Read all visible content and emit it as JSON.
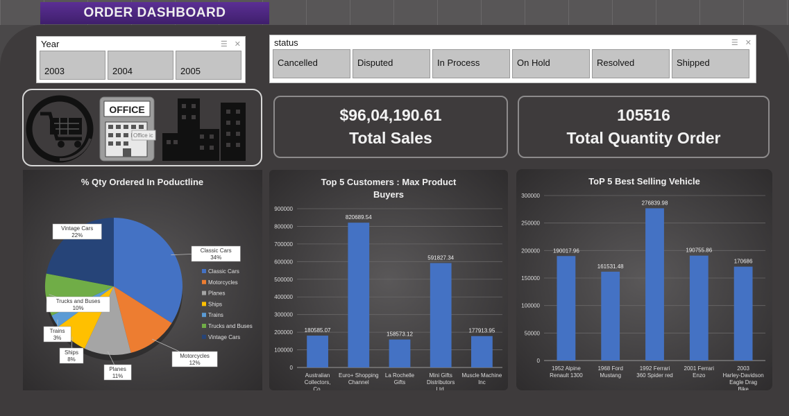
{
  "header": {
    "title": "ORDER DASHBOARD"
  },
  "slicers": {
    "year": {
      "title": "Year",
      "items": [
        "2003",
        "2004",
        "2005"
      ]
    },
    "status": {
      "title": "status",
      "items": [
        "Cancelled",
        "Disputed",
        "In Process",
        "On Hold",
        "Resolved",
        "Shipped"
      ]
    }
  },
  "icons": {
    "office_label": "OFFICE",
    "office_tooltip": "Office ic"
  },
  "kpis": {
    "sales": {
      "value": "$96,04,190.61",
      "label": "Total Sales"
    },
    "quantity": {
      "value": "105516",
      "label": "Total Quantity Order"
    }
  },
  "colors": {
    "bar": "#4472c4",
    "pie": [
      "#4472c4",
      "#ed7d31",
      "#a5a5a5",
      "#ffc000",
      "#5b9bd5",
      "#70ad47",
      "#264478"
    ]
  },
  "chart_data": [
    {
      "type": "pie",
      "title": "% Qty Ordered In Poductline",
      "categories": [
        "Classic Cars",
        "Motorcycles",
        "Planes",
        "Ships",
        "Trains",
        "Trucks and Buses",
        "Vintage Cars"
      ],
      "values": [
        34,
        12,
        11,
        8,
        3,
        10,
        22
      ],
      "labels": [
        "34%",
        "12%",
        "11%",
        "8%",
        "3%",
        "10%",
        "22%"
      ],
      "legend": "right"
    },
    {
      "type": "bar",
      "title": "Top 5 Customers : Max Product Buyers",
      "categories": [
        "Australian Collectors, Co.",
        "Euro+ Shopping Channel",
        "La Rochelle Gifts",
        "Mini Gifts Distributors Ltd.",
        "Muscle Machine Inc"
      ],
      "values": [
        180585.07,
        820689.54,
        158573.12,
        591827.34,
        177913.95
      ],
      "value_labels": [
        "180585.07",
        "820689.54",
        "158573.12",
        "591827.34",
        "177913.95"
      ],
      "ylim": [
        0,
        900000
      ],
      "yticks": [
        "0",
        "100000",
        "200000",
        "300000",
        "400000",
        "500000",
        "600000",
        "700000",
        "800000",
        "900000"
      ],
      "grid": true
    },
    {
      "type": "bar",
      "title": "ToP 5 Best Selling Vehicle",
      "categories": [
        "1952 Alpine Renault 1300",
        "1968 Ford Mustang",
        "1992 Ferrari 360 Spider red",
        "2001 Ferrari Enzo",
        "2003 Harley-Davidson Eagle Drag Bike"
      ],
      "values": [
        190017.96,
        161531.48,
        276839.98,
        190755.86,
        170686
      ],
      "value_labels": [
        "190017.96",
        "161531.48",
        "276839.98",
        "190755.86",
        "170686"
      ],
      "ylim": [
        0,
        300000
      ],
      "yticks": [
        "0",
        "50000",
        "100000",
        "150000",
        "200000",
        "250000",
        "300000"
      ],
      "grid": true
    }
  ]
}
